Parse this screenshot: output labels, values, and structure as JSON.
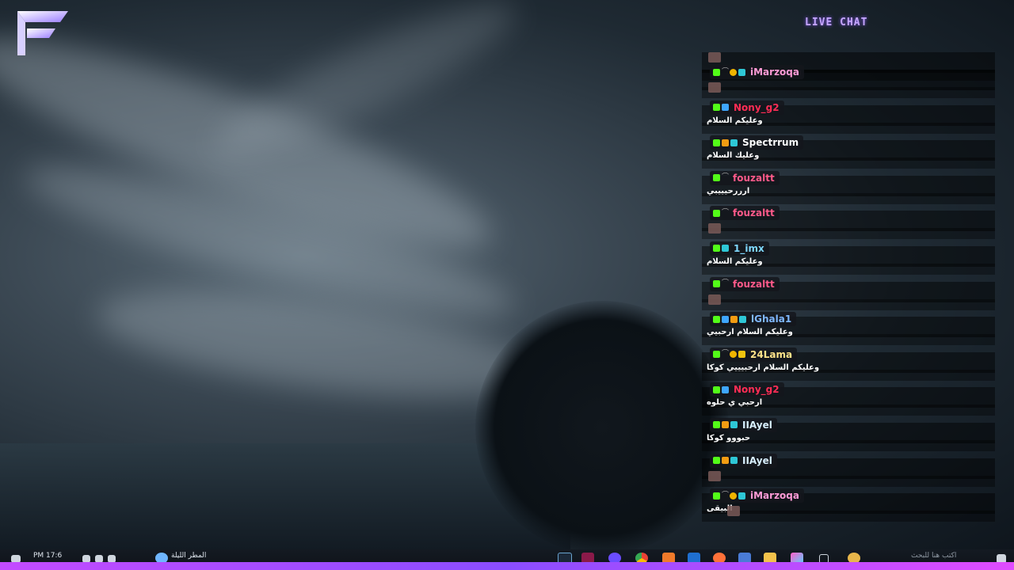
{
  "overlay": {
    "live_chat_title": "LIVE CHAT"
  },
  "chat": {
    "messages": [
      {
        "user": "",
        "color": "#ffffff",
        "badges": [],
        "text": "",
        "emote": true
      },
      {
        "user": "iMarzoqa",
        "color": "#ff9bd6",
        "badges": [
          "k",
          "tilde",
          "sub",
          "mod"
        ],
        "text": "",
        "emote": true
      },
      {
        "user": "Nony_g2",
        "color": "#ff2d55",
        "badges": [
          "k",
          "blue"
        ],
        "text": "وعليكم السلام",
        "emote": false
      },
      {
        "user": "Spectrrum",
        "color": "#ffffff",
        "badges": [
          "k",
          "flag",
          "mod"
        ],
        "text": "وعليك السلام",
        "emote": false
      },
      {
        "user": "fouzaltt",
        "color": "#ff5a8a",
        "badges": [
          "k",
          "tilde"
        ],
        "text": "ارررحيييبي",
        "emote": false
      },
      {
        "user": "fouzaltt",
        "color": "#ff5a8a",
        "badges": [
          "k",
          "tilde"
        ],
        "text": "",
        "emote": true
      },
      {
        "user": "1_imx",
        "color": "#7fd8ff",
        "badges": [
          "k",
          "mod"
        ],
        "text": "وعليكم السلام",
        "emote": false
      },
      {
        "user": "fouzaltt",
        "color": "#ff5a8a",
        "badges": [
          "k",
          "tilde"
        ],
        "text": "",
        "emote": true
      },
      {
        "user": "lGhala1",
        "color": "#7fb8ff",
        "badges": [
          "k",
          "blue",
          "flag",
          "mod"
        ],
        "text": "وعليكم السلام ارحبيي",
        "emote": false
      },
      {
        "user": "24Lama",
        "color": "#ffe38a",
        "badges": [
          "k",
          "tilde",
          "sub",
          "crown"
        ],
        "text": "وعليكم السلام ارحبيييي كوكا",
        "emote": false
      },
      {
        "user": "Nony_g2",
        "color": "#ff2d55",
        "badges": [
          "k",
          "blue"
        ],
        "text": "ارحبي ي حلوه",
        "emote": false
      },
      {
        "user": "IIAyel",
        "color": "#d8f0ff",
        "badges": [
          "k",
          "flag",
          "mod"
        ],
        "text": "حبووو كوكا",
        "emote": false
      },
      {
        "user": "IIAyel",
        "color": "#d8f0ff",
        "badges": [
          "k",
          "flag",
          "mod"
        ],
        "text": "",
        "emote": true
      },
      {
        "user": "iMarzoqa",
        "color": "#ff9bd6",
        "badges": [
          "k",
          "tilde",
          "sub",
          "mod"
        ],
        "text": "البيقى",
        "emote": true
      }
    ]
  },
  "taskbar": {
    "clock": "PM 17:6",
    "weather": "المطر الليلة",
    "search_placeholder": "اكتب هنا للبحث"
  },
  "colors": {
    "accent": "#8a4dff",
    "kick_green": "#53fc18"
  }
}
